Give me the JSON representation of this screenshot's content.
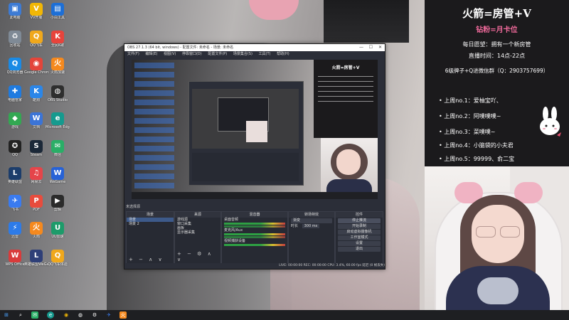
{
  "desktop_icons": [
    {
      "label": "此电脑",
      "color": "#3d7bd4",
      "glyph": "▣"
    },
    {
      "label": "VV开服",
      "color": "#f2b705",
      "glyph": "V"
    },
    {
      "label": "小白工具",
      "color": "#1d6fd6",
      "glyph": "▤"
    },
    {
      "label": "回收站",
      "color": "#7f8a96",
      "glyph": "♻"
    },
    {
      "label": "QQ飞车",
      "color": "#f0a81c",
      "glyph": "Q"
    },
    {
      "label": "全民K歌",
      "color": "#e7443c",
      "glyph": "K"
    },
    {
      "label": "QQ浏览器",
      "color": "#1a8ae5",
      "glyph": "Q"
    },
    {
      "label": "Google Chrome",
      "color": "#e3453a",
      "glyph": "◉"
    },
    {
      "label": "火箭加速",
      "color": "#f5891e",
      "glyph": "火"
    },
    {
      "label": "电脑管家",
      "color": "#1f7be0",
      "glyph": "✚"
    },
    {
      "label": "酷狗",
      "color": "#2b86e8",
      "glyph": "K"
    },
    {
      "label": "OBS Studio",
      "color": "#2e2e2e",
      "glyph": "◍"
    },
    {
      "label": "游戏",
      "color": "#33a852",
      "glyph": "◆"
    },
    {
      "label": "文档",
      "color": "#3b74d6",
      "glyph": "W"
    },
    {
      "label": "Microsoft Edge",
      "color": "#159a8e",
      "glyph": "e"
    },
    {
      "label": "QQ",
      "color": "#222",
      "glyph": "✪"
    },
    {
      "label": "Steam",
      "color": "#1b2838",
      "glyph": "S"
    },
    {
      "label": "微信",
      "color": "#2aae67",
      "glyph": "✉"
    },
    {
      "label": "英雄联盟",
      "color": "#1c3d6b",
      "glyph": "L"
    },
    {
      "label": "网易云",
      "color": "#e5454a",
      "glyph": "♫"
    },
    {
      "label": "WeGame",
      "color": "#2762d6",
      "glyph": "W"
    },
    {
      "label": "飞书",
      "color": "#3a7bf0",
      "glyph": "✈"
    },
    {
      "label": "PDF",
      "color": "#e84c3d",
      "glyph": "P"
    },
    {
      "label": "剪辑",
      "color": "#2b2b2b",
      "glyph": "▶"
    },
    {
      "label": "迅雷",
      "color": "#2d7be8",
      "glyph": "⚡"
    },
    {
      "label": "火箭",
      "color": "#f5891e",
      "glyph": "火"
    },
    {
      "label": "UU加速",
      "color": "#1d9b6a",
      "glyph": "U"
    },
    {
      "label": "WPS Office",
      "color": "#d93b3b",
      "glyph": "W"
    },
    {
      "label": "英雄联盟WeGame",
      "color": "#2e3f78",
      "glyph": "L"
    },
    {
      "label": "QQ飞车体验",
      "color": "#f0a81c",
      "glyph": "Q"
    }
  ],
  "obs": {
    "title": "OBS 27.1.3 (64 bit, windows) - 配置文件: 未命名 - 场景: 未命名",
    "menu": [
      "文件(F)",
      "编辑(E)",
      "视图(V)",
      "停靠窗口(D)",
      "配置文件(P)",
      "场景集合(S)",
      "工具(T)",
      "帮助(H)"
    ],
    "status_strip": "未选择源",
    "docks": {
      "scenes": {
        "header": "场景",
        "items": [
          "场景",
          "场景 2"
        ]
      },
      "sources": {
        "header": "来源",
        "items": [
          "游戏源",
          "窗口采集",
          "画板",
          "显示器采集"
        ]
      },
      "mixer": {
        "header": "混音器",
        "items": [
          "桌面音频",
          "麦克风/Aux",
          "视频捕获设备"
        ]
      },
      "transitions": {
        "header": "转场特效",
        "fade": "渐变",
        "duration_label": "时长",
        "duration": "300 ms"
      },
      "controls": {
        "header": "控件",
        "buttons": [
          "停止推流",
          "开始录制",
          "启动虚拟摄像机",
          "工作室模式",
          "设置",
          "退出"
        ]
      }
    },
    "statusbar": "LIVE: 00:00:00   REC: 00:00:00   CPU: 3.4%, 60.00 fps   延迟 (0 帧丢失)"
  },
  "overlay": {
    "title": "火箭=房管+V",
    "subtitle": "钻粉=月卡位",
    "wish": "每日愿望：拥有一个新房管",
    "hours": "直播时间：14点-22点",
    "contact": "6级牌子+Q进微信群（Q：2903757699）",
    "ranking": [
      "上周no.1：爱柚宝吖、",
      "上周no.2：阿噗噗噗~",
      "上周no.3：菜噗噗~",
      "上周no.4：小脑袋的小夫君",
      "上周no.5：99999、俞二宝"
    ]
  },
  "taskbar": {
    "icons": [
      "start-icon",
      "search-icon",
      "wechat-icon",
      "edge-icon",
      "browser-icon",
      "obs-icon",
      "steam-icon",
      "feishu-icon",
      "qq-icon",
      "wegame-icon"
    ]
  }
}
